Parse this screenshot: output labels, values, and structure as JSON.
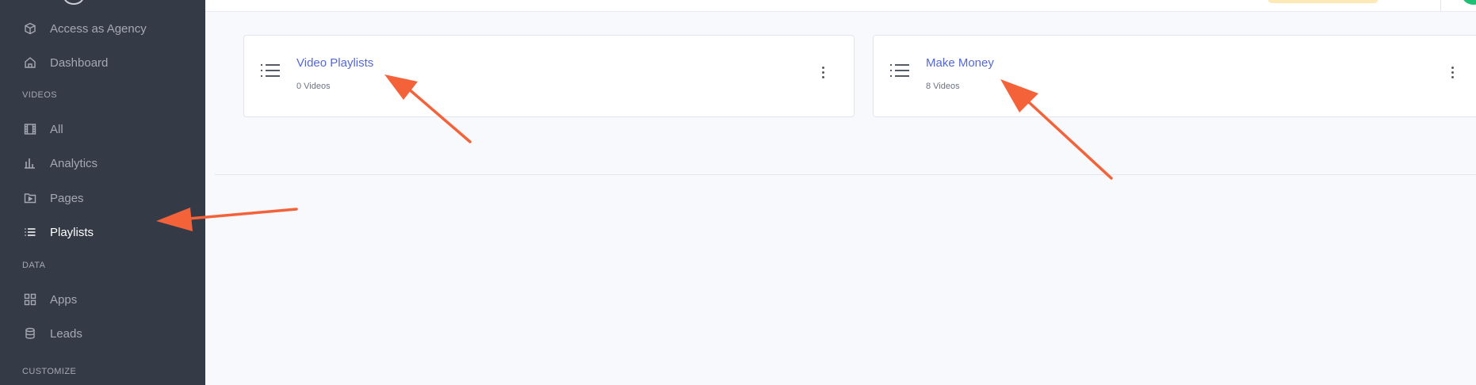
{
  "sidebar": {
    "items_top": [
      {
        "label": "Access as Agency",
        "icon": "box-icon"
      },
      {
        "label": "Dashboard",
        "icon": "home-icon"
      }
    ],
    "section_videos": "VIDEOS",
    "items_videos": [
      {
        "label": "All",
        "icon": "film-icon"
      },
      {
        "label": "Analytics",
        "icon": "bar-chart-icon"
      },
      {
        "label": "Pages",
        "icon": "folder-icon"
      },
      {
        "label": "Playlists",
        "icon": "list-icon",
        "active": true
      }
    ],
    "section_data": "DATA",
    "items_data": [
      {
        "label": "Apps",
        "icon": "grid-icon"
      },
      {
        "label": "Leads",
        "icon": "database-icon"
      }
    ],
    "section_customize": "CUSTOMIZE"
  },
  "playlists": [
    {
      "title": "Video Playlists",
      "count": "0 Videos"
    },
    {
      "title": "Make Money",
      "count": "8 Videos"
    }
  ],
  "colors": {
    "sidebar_bg": "#343a46",
    "link": "#5468d4",
    "annotation_arrow": "#f4623a",
    "page_bg": "#f8f9fc"
  }
}
